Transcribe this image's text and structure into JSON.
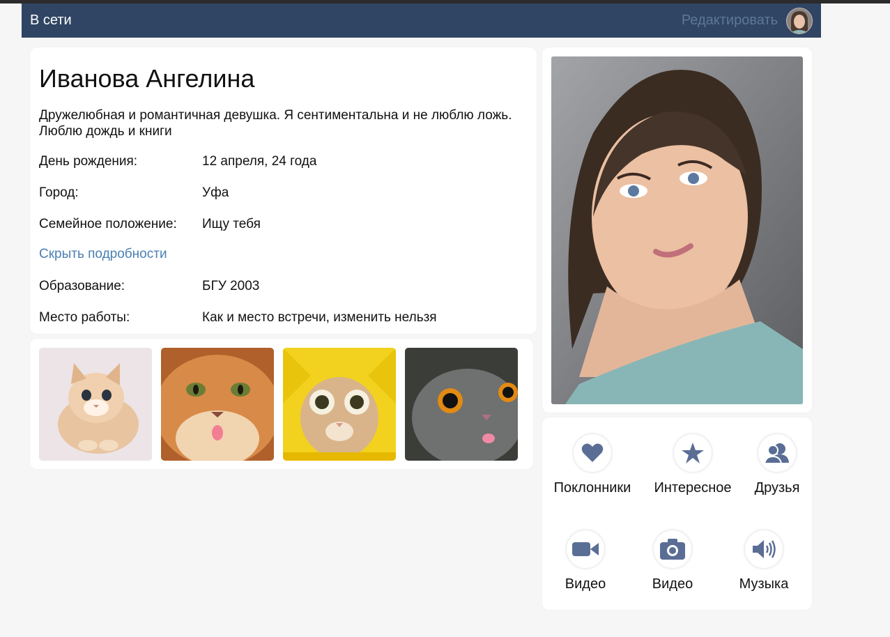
{
  "header": {
    "status": "В сети",
    "edit_label": "Редактировать",
    "avatar_icon": "user-avatar"
  },
  "profile": {
    "name": "Иванова Ангелина",
    "about": "Дружелюбная и романтичная девушка. Я сентиментальна и не люблю ложь. Люблю дождь и книги",
    "fields": [
      {
        "label": "День рождения:",
        "value": "12 апреля, 24 года"
      },
      {
        "label": "Город:",
        "value": "Уфа"
      },
      {
        "label": "Семейное положение:",
        "value": "Ищу тебя"
      }
    ],
    "hide_details": "Скрыть подробности",
    "extra_fields": [
      {
        "label": "Образование:",
        "value": "БГУ 2003"
      },
      {
        "label": "Место работы:",
        "value": "Как и место встречи, изменить нельзя"
      }
    ]
  },
  "photos": [
    "cat-photo-1",
    "cat-photo-2",
    "cat-photo-3",
    "cat-photo-4"
  ],
  "menu": {
    "items": [
      {
        "label": "Поклонники",
        "icon": "heart-icon"
      },
      {
        "label": "Интересное",
        "icon": "star-icon"
      },
      {
        "label": "Друзья",
        "icon": "friends-icon"
      },
      {
        "label": "Видео",
        "icon": "video-camera-icon"
      },
      {
        "label": "Видео",
        "icon": "photo-camera-icon"
      },
      {
        "label": "Музыка",
        "icon": "speaker-icon"
      }
    ]
  },
  "colors": {
    "header_bg": "#304563",
    "link": "#4a7fb3",
    "icon": "#5a6d95"
  }
}
